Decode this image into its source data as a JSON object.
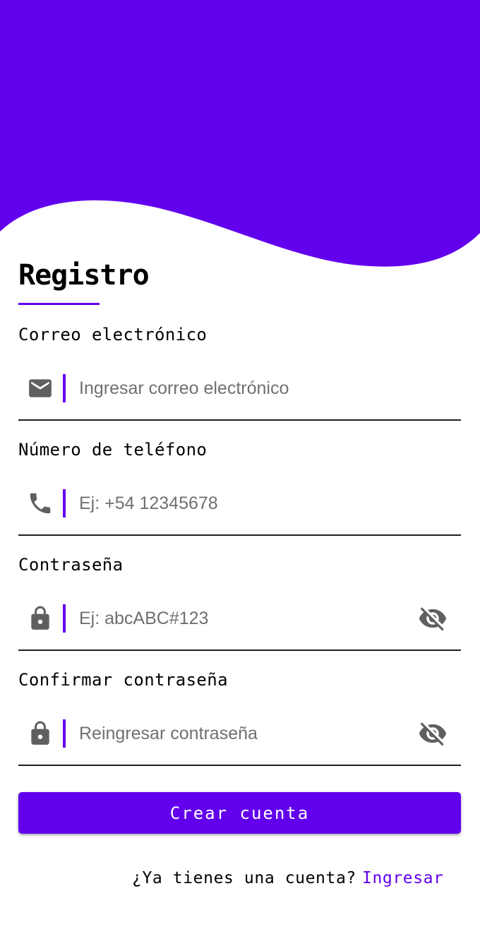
{
  "theme": {
    "accent": "#6200ee",
    "background": "#ffffff",
    "text": "#000000",
    "placeholder": "#707070"
  },
  "title": "Registro",
  "fields": [
    {
      "label": "Correo electrónico",
      "placeholder": "Ingresar correo electrónico",
      "icon": "mail-icon",
      "value": ""
    },
    {
      "label": "Número de teléfono",
      "placeholder": "Ej: +54 12345678",
      "icon": "phone-icon",
      "value": ""
    },
    {
      "label": "Contraseña",
      "placeholder": "Ej: abcABC#123",
      "icon": "lock-icon",
      "value": "",
      "toggle_icon": "eye-off-icon"
    },
    {
      "label": "Confirmar contraseña",
      "placeholder": "Reingresar contraseña",
      "icon": "lock-icon",
      "value": "",
      "toggle_icon": "eye-off-icon"
    }
  ],
  "submit_label": "Crear cuenta",
  "footer": {
    "question": "¿Ya tienes una cuenta?",
    "link": "Ingresar"
  }
}
